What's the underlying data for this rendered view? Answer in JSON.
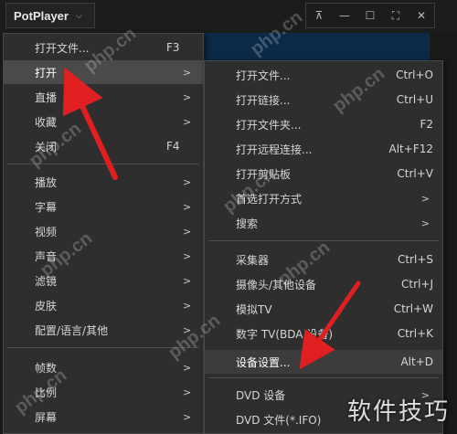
{
  "titlebar": {
    "app_name": "PotPlayer",
    "controls": [
      "⊼",
      "—",
      "☐",
      "⛶",
      "✕"
    ]
  },
  "main_menu": {
    "items": [
      {
        "label": "打开文件...",
        "shortcut": "F3",
        "submenu": false
      },
      {
        "label": "打开",
        "shortcut": "",
        "submenu": true,
        "highlighted": true
      },
      {
        "label": "直播",
        "shortcut": "",
        "submenu": true
      },
      {
        "label": "收藏",
        "shortcut": "",
        "submenu": true
      },
      {
        "label": "关闭",
        "shortcut": "F4",
        "submenu": false
      },
      {
        "label": "播放",
        "shortcut": "",
        "submenu": true
      },
      {
        "label": "字幕",
        "shortcut": "",
        "submenu": true
      },
      {
        "label": "视频",
        "shortcut": "",
        "submenu": true
      },
      {
        "label": "声音",
        "shortcut": "",
        "submenu": true
      },
      {
        "label": "滤镜",
        "shortcut": "",
        "submenu": true
      },
      {
        "label": "皮肤",
        "shortcut": "",
        "submenu": true
      },
      {
        "label": "配置/语言/其他",
        "shortcut": "",
        "submenu": true
      },
      {
        "label": "帧数",
        "shortcut": "",
        "submenu": true
      },
      {
        "label": "比例",
        "shortcut": "",
        "submenu": true
      },
      {
        "label": "屏幕",
        "shortcut": "",
        "submenu": true
      }
    ]
  },
  "sub_menu": {
    "items": [
      {
        "label": "打开文件...",
        "shortcut": "Ctrl+O",
        "submenu": false
      },
      {
        "label": "打开链接...",
        "shortcut": "Ctrl+U",
        "submenu": false
      },
      {
        "label": "打开文件夹...",
        "shortcut": "F2",
        "submenu": false
      },
      {
        "label": "打开远程连接...",
        "shortcut": "Alt+F12",
        "submenu": false
      },
      {
        "label": "打开剪贴板",
        "shortcut": "Ctrl+V",
        "submenu": false
      },
      {
        "label": "首选打开方式",
        "shortcut": "",
        "submenu": true
      },
      {
        "label": "搜索",
        "shortcut": "",
        "submenu": true
      },
      {
        "label": "采集器",
        "shortcut": "Ctrl+S",
        "submenu": false
      },
      {
        "label": "摄像头/其他设备",
        "shortcut": "Ctrl+J",
        "submenu": false
      },
      {
        "label": "模拟TV",
        "shortcut": "Ctrl+W",
        "submenu": false
      },
      {
        "label": "数字 TV(BDA 设备)",
        "shortcut": "Ctrl+K",
        "submenu": false
      },
      {
        "label": "设备设置...",
        "shortcut": "Alt+D",
        "submenu": false,
        "highlighted": true
      },
      {
        "label": "DVD 设备",
        "shortcut": "",
        "submenu": true
      },
      {
        "label": "DVD 文件(*.IFO)",
        "shortcut": "",
        "submenu": false
      }
    ]
  },
  "watermark": {
    "site": "php.cn",
    "corner_text": "软件技巧"
  },
  "colors": {
    "menu_bg": "#2e2e2e",
    "highlight": "#4a4a4a",
    "annotation_arrow": "#e02020",
    "title_bg": "#1c1c1c",
    "blue_strip": "#0b2a48"
  }
}
